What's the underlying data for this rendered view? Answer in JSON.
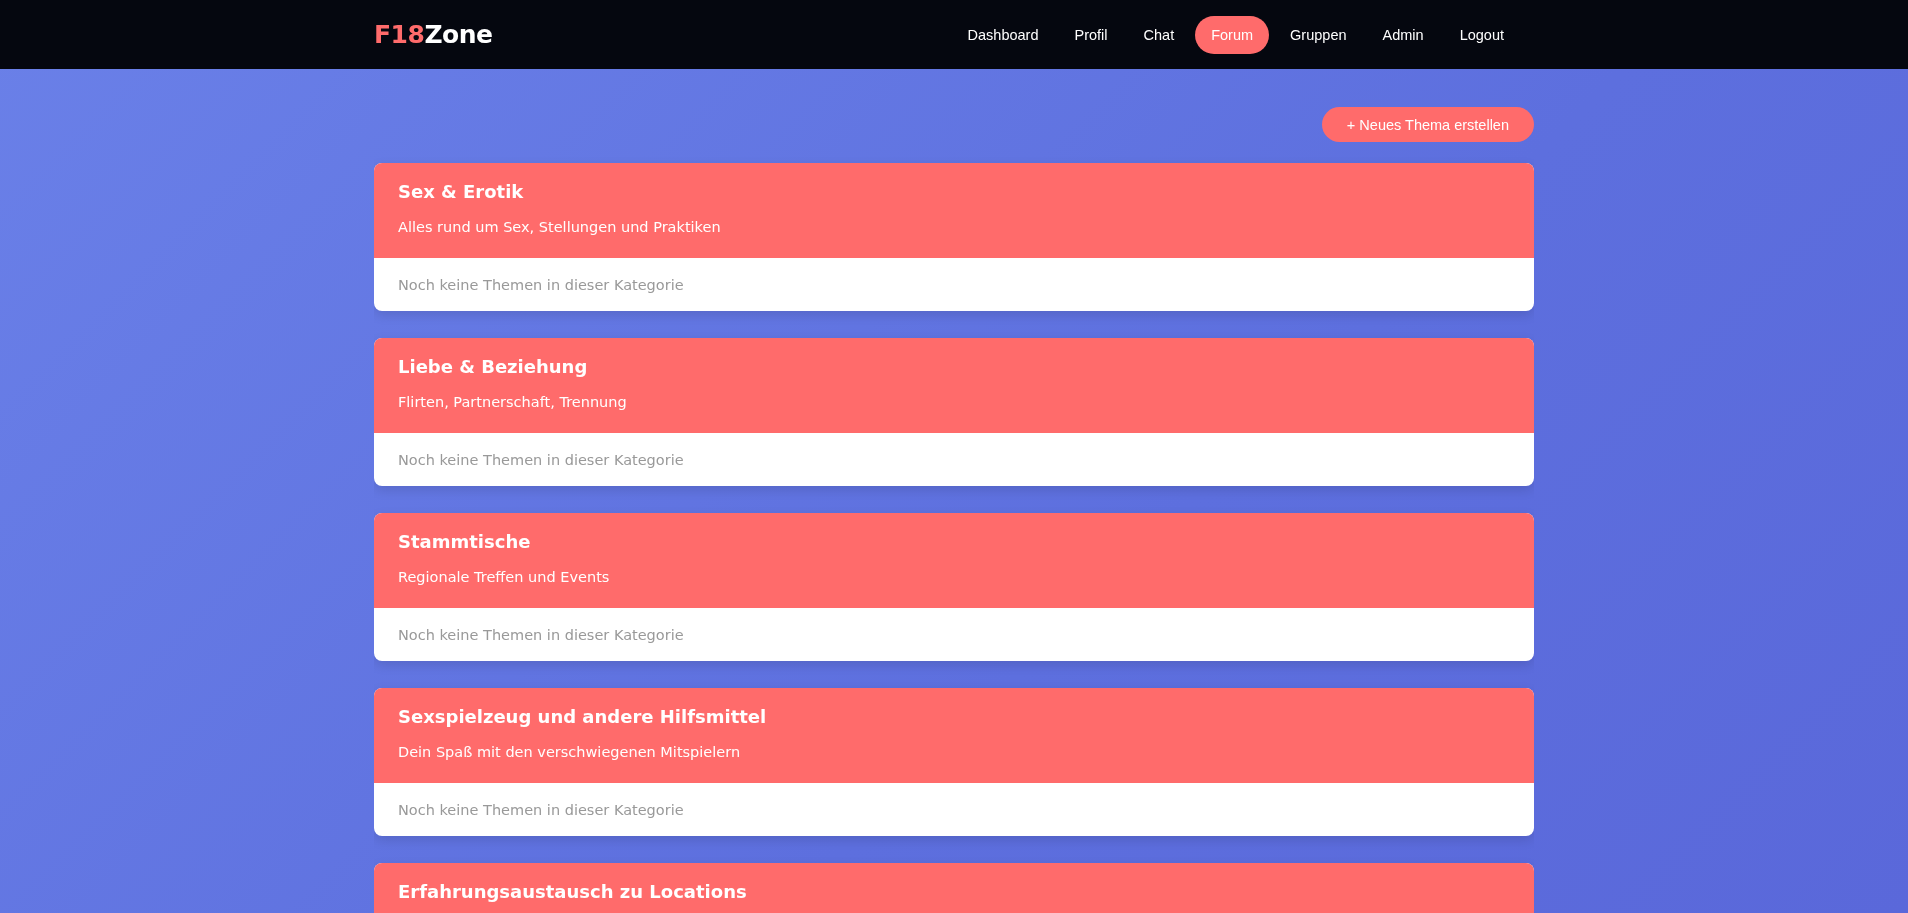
{
  "header": {
    "logo": {
      "accent": "F18",
      "rest": "Zone"
    },
    "nav": [
      {
        "label": "Dashboard",
        "selected": false
      },
      {
        "label": "Profil",
        "selected": false
      },
      {
        "label": "Chat",
        "selected": false
      },
      {
        "label": "Forum",
        "selected": true
      },
      {
        "label": "Gruppen",
        "selected": false
      },
      {
        "label": "Admin",
        "selected": false
      },
      {
        "label": "Logout",
        "selected": false
      }
    ]
  },
  "new_topic_button": "+ Neues Thema erstellen",
  "categories": [
    {
      "title": "Sex & Erotik",
      "description": "Alles rund um Sex, Stellungen und Praktiken",
      "empty_text": "Noch keine Themen in dieser Kategorie"
    },
    {
      "title": "Liebe & Beziehung",
      "description": "Flirten, Partnerschaft, Trennung",
      "empty_text": "Noch keine Themen in dieser Kategorie"
    },
    {
      "title": "Stammtische",
      "description": "Regionale Treffen und Events",
      "empty_text": "Noch keine Themen in dieser Kategorie"
    },
    {
      "title": "Sexspielzeug und andere Hilfsmittel",
      "description": "Dein Spaß mit den verschwiegenen Mitspielern",
      "empty_text": "Noch keine Themen in dieser Kategorie"
    },
    {
      "title": "Erfahrungsaustausch zu Locations"
    }
  ]
}
